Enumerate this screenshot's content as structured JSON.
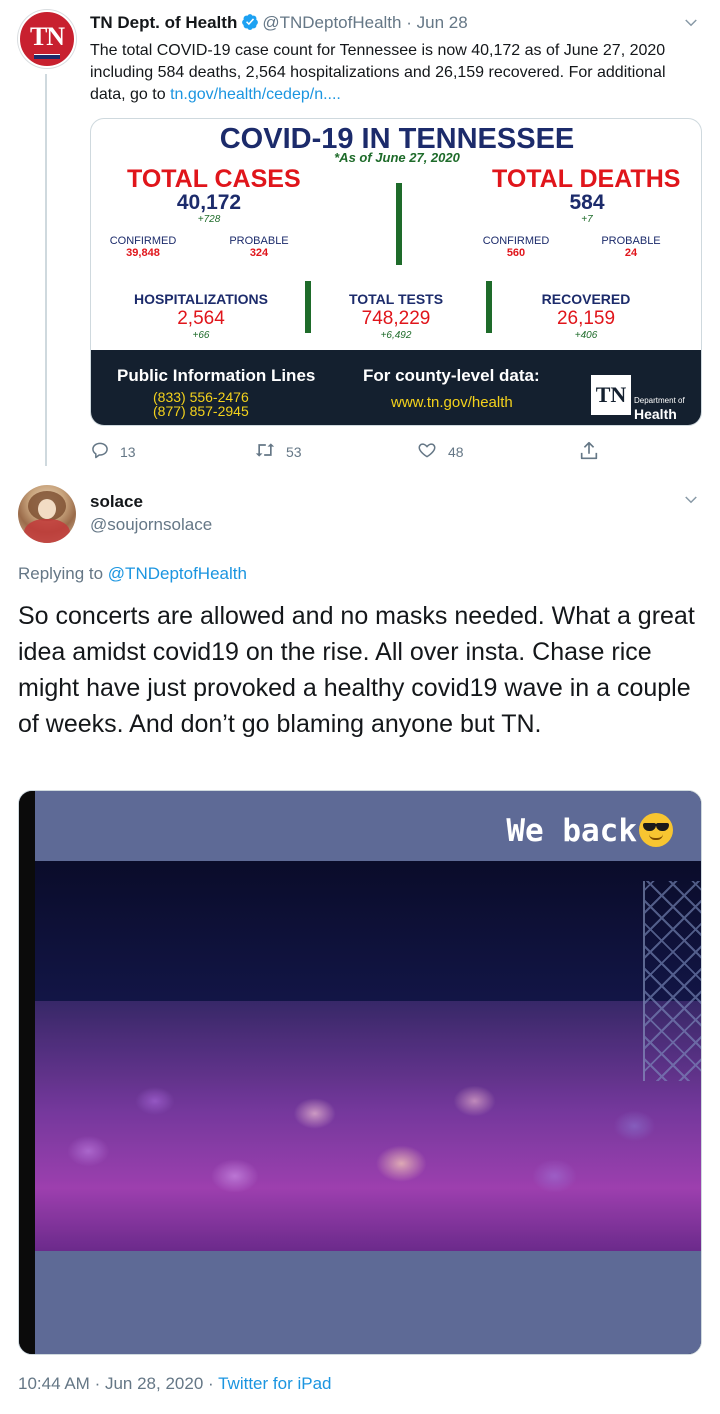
{
  "tweet1": {
    "avatar_text": "TN",
    "name": "TN Dept. of Health",
    "handle": "@TNDeptofHealth",
    "separator": "·",
    "date": "Jun 28",
    "text": "The total COVID-19 case count for Tennessee is now 40,172 as of June 27, 2020 including 584 deaths, 2,564 hospitalizations and 26,159 recovered. For additional data, go to",
    "link": "tn.gov/health/cedep/n....",
    "actions": {
      "replies": "13",
      "retweets": "53",
      "likes": "48"
    }
  },
  "infographic": {
    "title": "COVID-19 IN TENNESSEE",
    "as_of": "*As of June 27, 2020",
    "total_cases": {
      "label": "TOTAL CASES",
      "value": "40,172",
      "delta": "+728",
      "confirmed_label": "CONFIRMED",
      "confirmed": "39,848",
      "probable_label": "PROBABLE",
      "probable": "324"
    },
    "total_deaths": {
      "label": "TOTAL DEATHS",
      "value": "584",
      "delta": "+7",
      "confirmed_label": "CONFIRMED",
      "confirmed": "560",
      "probable_label": "PROBABLE",
      "probable": "24"
    },
    "hospitalizations": {
      "label": "HOSPITALIZATIONS",
      "value": "2,564",
      "delta": "+66"
    },
    "total_tests": {
      "label": "TOTAL TESTS",
      "value": "748,229",
      "delta": "+6,492"
    },
    "recovered": {
      "label": "RECOVERED",
      "value": "26,159",
      "delta": "+406"
    },
    "footer": {
      "public_info": "Public Information Lines",
      "phone1": "(833) 556-2476",
      "phone2": "(877) 857-2945",
      "county_label": "For county-level data:",
      "county_url": "www.tn.gov/health",
      "logo": "TN",
      "dept": "Department of",
      "health": "Health"
    },
    "colors": {
      "navy": "#1c2b6b",
      "red": "#e0151b",
      "green": "#1e6b2a",
      "footer_bg": "#14202f",
      "yellow": "#f4d21c"
    }
  },
  "tweet2": {
    "name": "solace",
    "handle": "@soujornsolace",
    "replying_prefix": "Replying to",
    "replying_to": "@TNDeptofHealth",
    "text": "So concerts are allowed and no masks needed. What a great idea amidst covid19 on the rise. All over insta. Chase rice might have just provoked a healthy covid19 wave in a couple of weeks. And don’t go blaming anyone but TN.",
    "media_caption": "We back",
    "media_emoji": "smiling-face-with-sunglasses"
  },
  "meta": {
    "time": "10:44 AM",
    "separator": "·",
    "date": "Jun 28, 2020",
    "separator2": "·",
    "source": "Twitter for iPad"
  },
  "icons": {
    "verified": "verified-badge-icon",
    "more": "chevron-down-icon",
    "reply": "reply-icon",
    "retweet": "retweet-icon",
    "like": "heart-icon",
    "share": "share-icon"
  },
  "accent": "#1b95e0"
}
